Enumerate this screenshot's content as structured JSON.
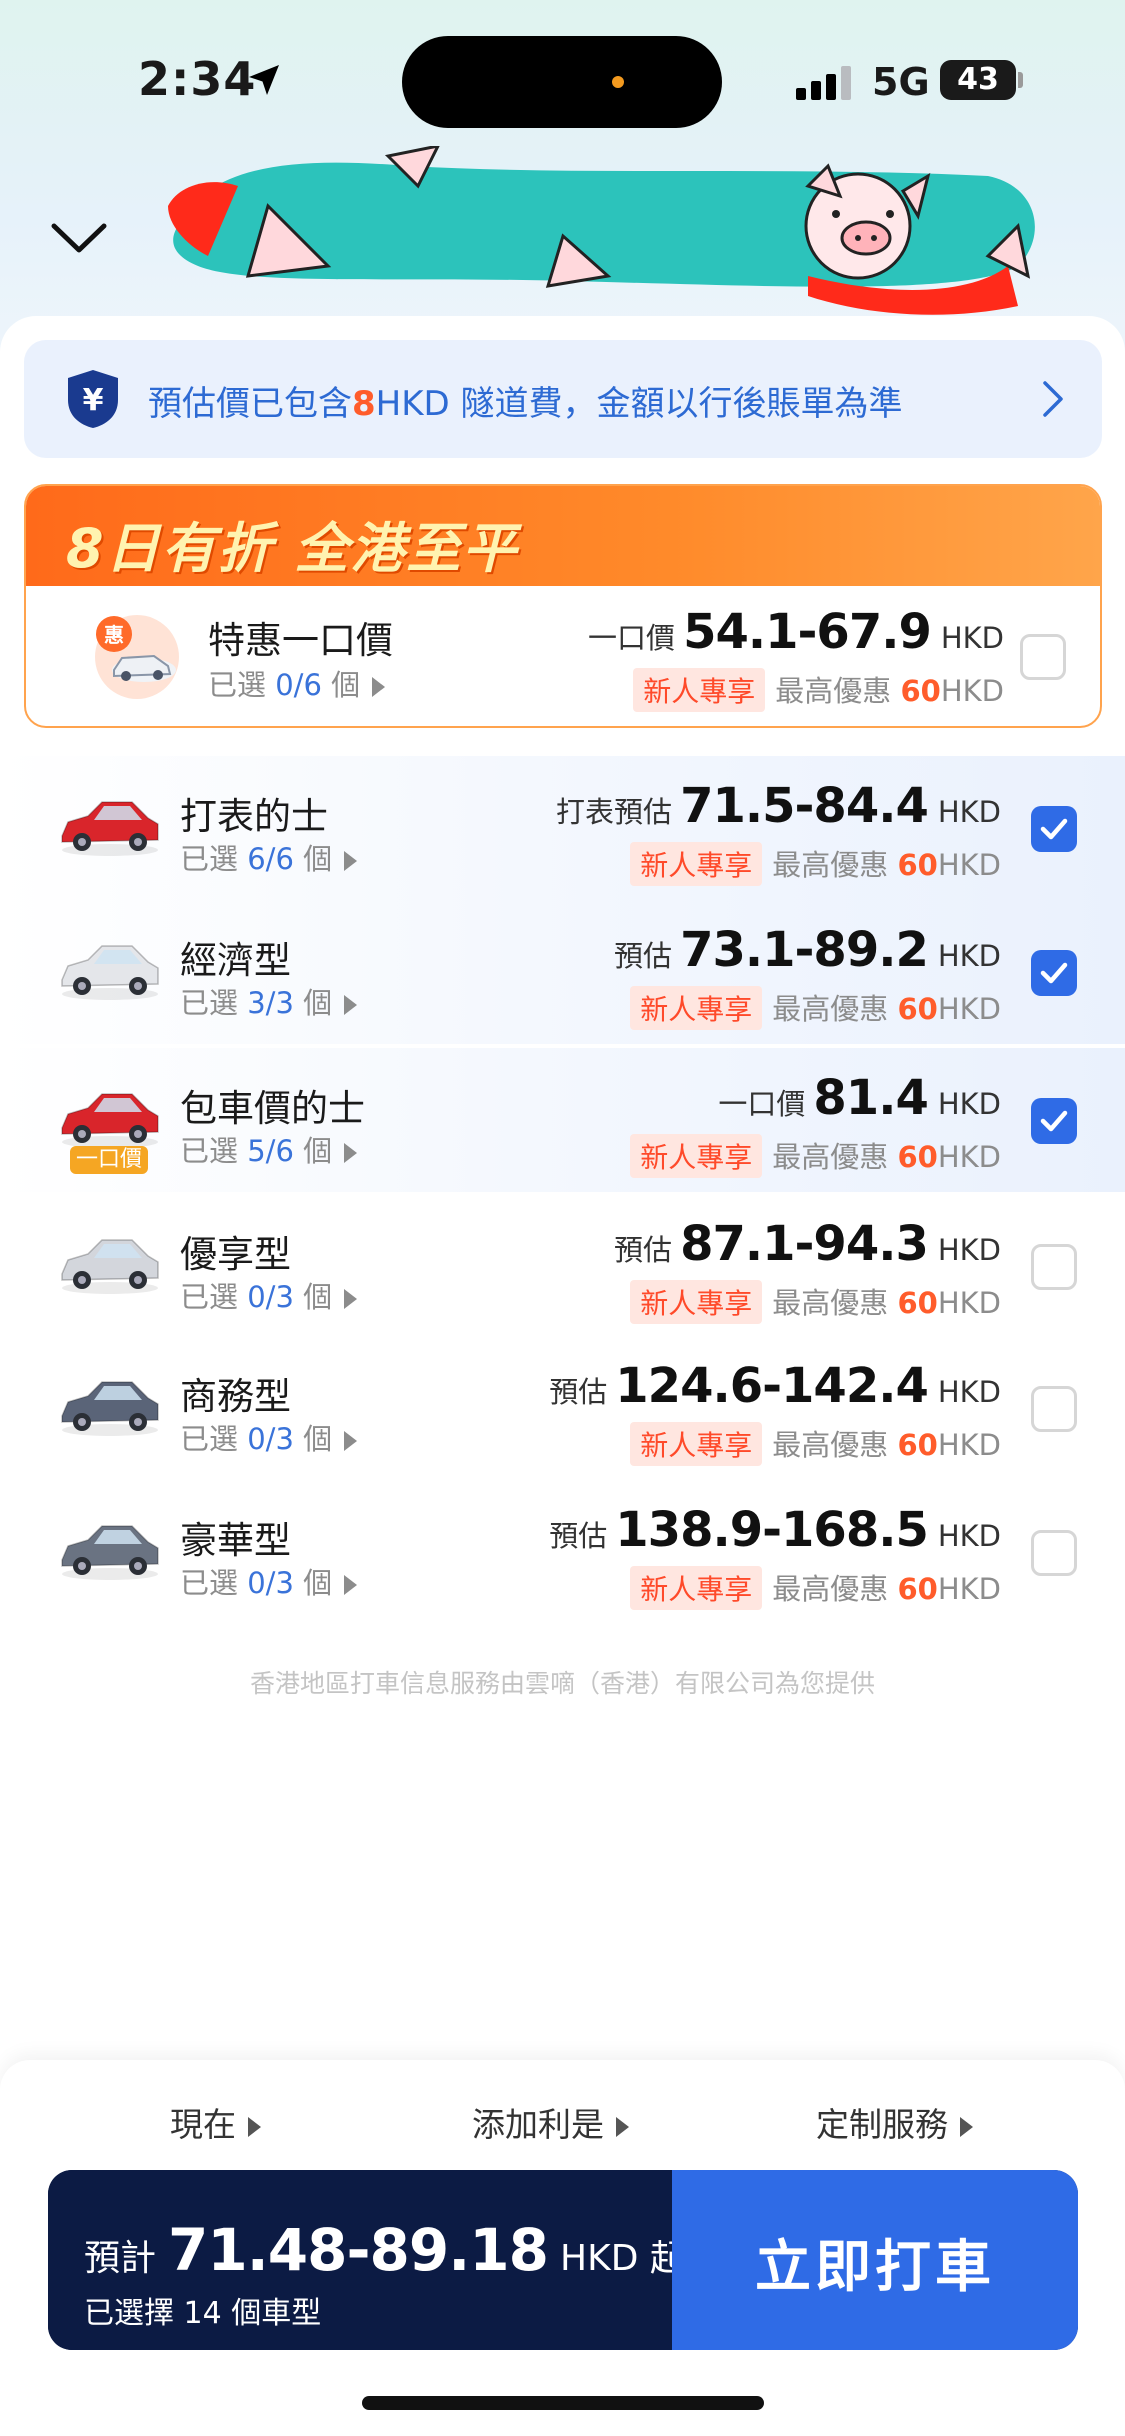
{
  "status_bar": {
    "time": "2:34",
    "network": "5G",
    "battery": "43"
  },
  "notice": {
    "text_before": "預估價已包含",
    "highlight": "8",
    "text_after": "HKD 隧道費，金額以行後賬單為準"
  },
  "promo": {
    "title": "8日有折 全港至平",
    "item": {
      "name": "特惠一口價",
      "badge_char": "惠",
      "selected_prefix": "已選",
      "selected_count": "0/6",
      "selected_suffix": "個",
      "price_label": "一口價",
      "price": "54.1-67.9",
      "unit": "HKD",
      "new_tag": "新人專享",
      "discount_label": "最高優惠",
      "discount_amount": "60",
      "discount_unit": "HKD",
      "checked": false
    }
  },
  "rides": [
    {
      "name": "打表的士",
      "selected_prefix": "已選",
      "selected_count": "6/6",
      "selected_suffix": "個",
      "price_label": "打表預估",
      "price": "71.5-84.4",
      "unit": "HKD",
      "new_tag": "新人專享",
      "discount_label": "最高優惠",
      "discount_amount": "60",
      "discount_unit": "HKD",
      "checked": true,
      "car_color": "#d9252b"
    },
    {
      "name": "經濟型",
      "selected_prefix": "已選",
      "selected_count": "3/3",
      "selected_suffix": "個",
      "price_label": "預估",
      "price": "73.1-89.2",
      "unit": "HKD",
      "new_tag": "新人專享",
      "discount_label": "最高優惠",
      "discount_amount": "60",
      "discount_unit": "HKD",
      "checked": true,
      "car_color": "#e4e6ea"
    },
    {
      "name": "包車價的士",
      "selected_prefix": "已選",
      "selected_count": "5/6",
      "selected_suffix": "個",
      "price_label": "一口價",
      "price": "81.4",
      "unit": "HKD",
      "new_tag": "新人專享",
      "discount_label": "最高優惠",
      "discount_amount": "60",
      "discount_unit": "HKD",
      "checked": true,
      "car_color": "#d9252b",
      "car_badge": "一口價"
    },
    {
      "name": "優享型",
      "selected_prefix": "已選",
      "selected_count": "0/3",
      "selected_suffix": "個",
      "price_label": "預估",
      "price": "87.1-94.3",
      "unit": "HKD",
      "new_tag": "新人專享",
      "discount_label": "最高優惠",
      "discount_amount": "60",
      "discount_unit": "HKD",
      "checked": false,
      "car_color": "#d3d6dc"
    },
    {
      "name": "商務型",
      "selected_prefix": "已選",
      "selected_count": "0/3",
      "selected_suffix": "個",
      "price_label": "預估",
      "price": "124.6-142.4",
      "unit": "HKD",
      "new_tag": "新人專享",
      "discount_label": "最高優惠",
      "discount_amount": "60",
      "discount_unit": "HKD",
      "checked": false,
      "car_color": "#5a6478"
    },
    {
      "name": "豪華型",
      "selected_prefix": "已選",
      "selected_count": "0/3",
      "selected_suffix": "個",
      "price_label": "預估",
      "price": "138.9-168.5",
      "unit": "HKD",
      "new_tag": "新人專享",
      "discount_label": "最高優惠",
      "discount_amount": "60",
      "discount_unit": "HKD",
      "checked": false,
      "car_color": "#6a7382"
    }
  ],
  "footnote": "香港地區打車信息服務由雲嘀（香港）有限公司為您提供",
  "options": {
    "time": "現在",
    "red_packet": "添加利是",
    "custom": "定制服務"
  },
  "cta": {
    "est_label": "預計",
    "est_value": "71.48-89.18",
    "est_unit": "HKD 起",
    "sub_text": "已選擇 14 個車型",
    "button_label": "立即打車"
  },
  "colors": {
    "accent_blue": "#2f6be6",
    "accent_orange": "#ff5c2b",
    "navy": "#0c1b44"
  }
}
